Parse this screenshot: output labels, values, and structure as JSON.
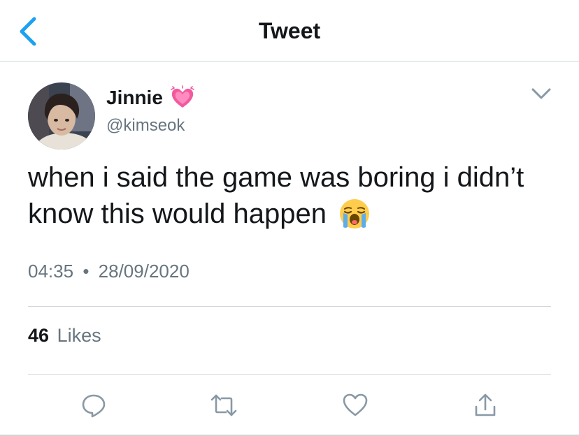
{
  "header": {
    "title": "Tweet"
  },
  "tweet": {
    "author_name": "Jinnie",
    "author_handle": "@kimseok",
    "text": "when i said the game was boring i didn’t know this would happen",
    "time": "04:35",
    "separator": "•",
    "date": "28/09/2020",
    "likes_count": "46",
    "likes_label": "Likes"
  },
  "icons": {
    "back": "chevron-left-icon",
    "name_emoji": "growing-heart-emoji",
    "text_emoji": "loudly-crying-face-emoji",
    "more": "chevron-down-icon",
    "reply": "speech-bubble-icon",
    "retweet": "retweet-icon",
    "like": "heart-icon",
    "share": "share-icon"
  },
  "colors": {
    "accent": "#1DA1F2",
    "secondary_text": "#66757F",
    "icon_gray": "#8899A6"
  }
}
